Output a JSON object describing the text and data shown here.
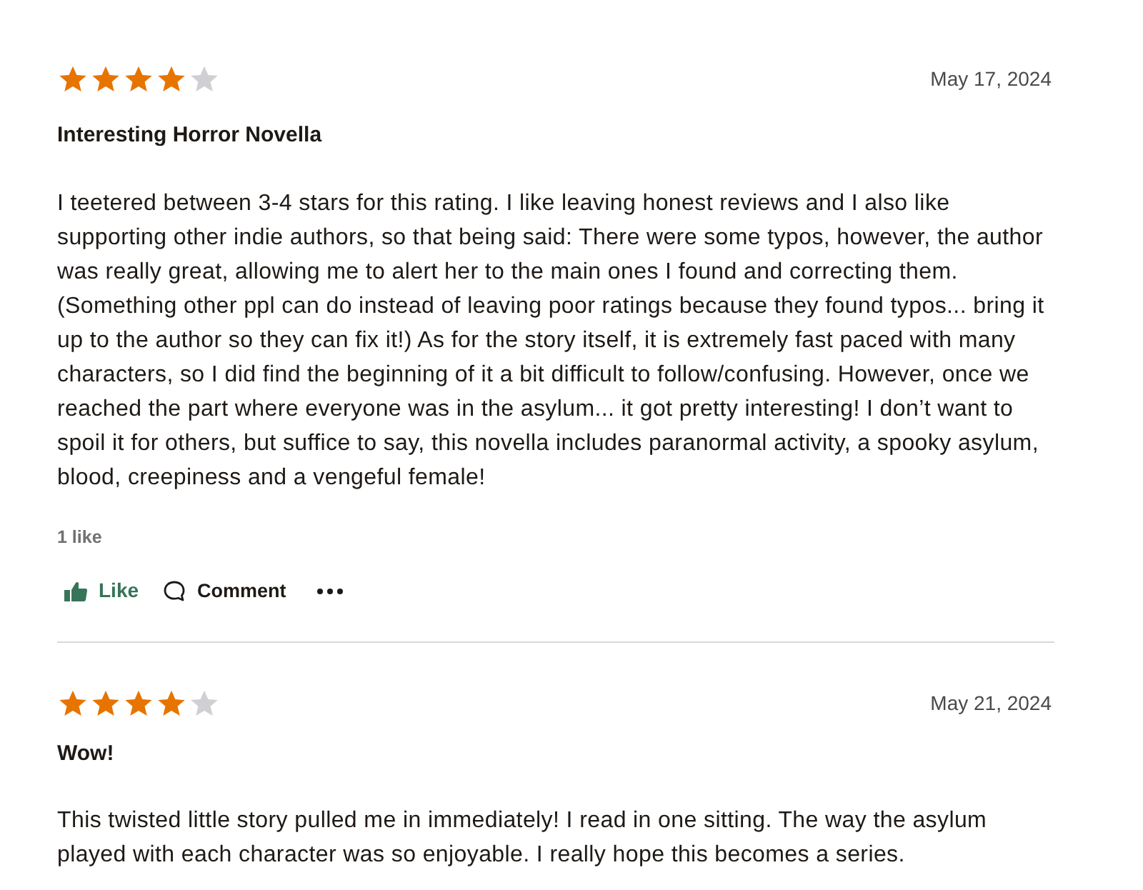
{
  "reviews": [
    {
      "stars": 4,
      "date": "May 17, 2024",
      "title": "Interesting Horror Novella",
      "body": "I teetered between 3-4 stars for this rating. I like leaving honest reviews and I also like supporting other indie authors, so that being said: There were some typos, however, the author was really great, allowing me to alert her to the main ones I found and correcting them. (Something other ppl can do instead of leaving poor ratings because they found typos... bring it up to the author so they can fix it!) As for the story itself, it is extremely fast paced with many characters, so I did find the beginning of it a bit difficult to follow/confusing. However, once we reached the part where everyone was in the asylum... it got pretty interesting! I don’t want to spoil it for others, but suffice to say, this novella includes paranormal activity, a spooky asylum, blood, creepiness and a vengeful female!",
      "likes": "1 like",
      "actions": [
        {
          "kind": "like",
          "label": "Like"
        },
        {
          "kind": "comment",
          "label": "Comment"
        },
        {
          "kind": "more"
        }
      ]
    },
    {
      "stars": 4,
      "date": "May 21, 2024",
      "title": "Wow!",
      "body": "This twisted little story pulled me in immediately! I read in one sitting. The way the asylum played with each character was so enjoyable. I really hope this becomes a series."
    }
  ]
}
